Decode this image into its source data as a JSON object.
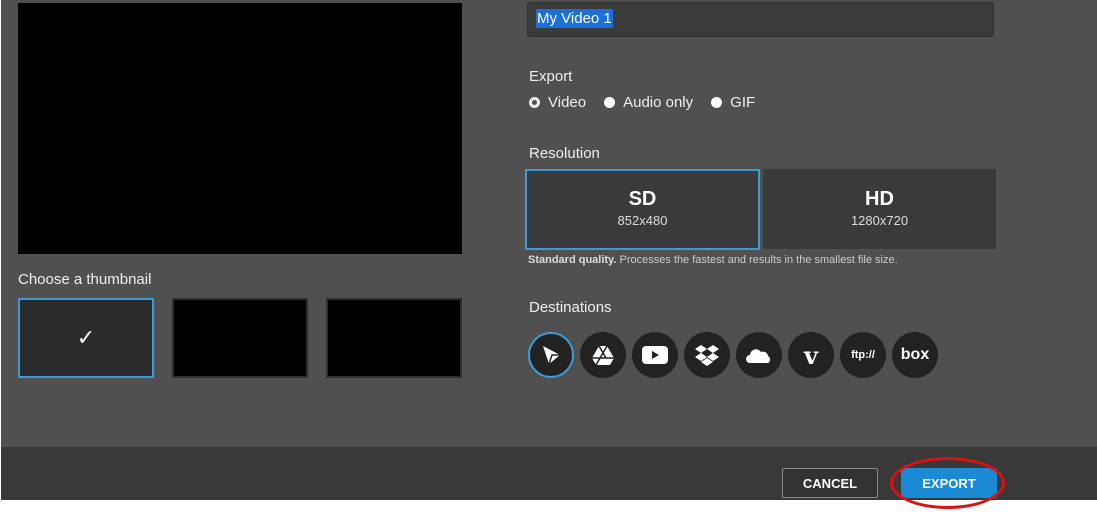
{
  "preview": {
    "thumbnail_label": "Choose a thumbnail",
    "selected_thumbnail": 1,
    "check": "✓"
  },
  "title_input": {
    "value": "My Video 1"
  },
  "export": {
    "label": "Export",
    "options": [
      "Video",
      "Audio only",
      "GIF"
    ],
    "selected": "Video"
  },
  "resolution": {
    "label": "Resolution",
    "options": [
      {
        "name": "SD",
        "size": "852x480"
      },
      {
        "name": "HD",
        "size": "1280x720"
      }
    ],
    "selected": "SD",
    "hint_bold": "Standard quality.",
    "hint": " Processes the fastest and results in the smallest file size."
  },
  "destinations": {
    "label": "Destinations",
    "items": [
      "screencast-o-matic",
      "google-drive",
      "youtube",
      "dropbox",
      "onedrive",
      "vimeo",
      "ftp://",
      "box"
    ],
    "ftp_label": "ftp://",
    "box_label": "box"
  },
  "footer": {
    "cancel": "CANCEL",
    "export": "EXPORT"
  },
  "colors": {
    "accent": "#3a9bd5",
    "export_button": "#1a8ad4",
    "highlight": "#d11111"
  }
}
